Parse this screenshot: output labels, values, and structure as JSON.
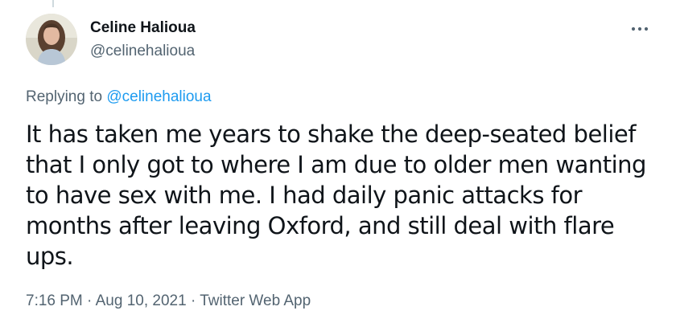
{
  "tweet": {
    "author": {
      "display_name": "Celine Halioua",
      "handle": "@celinehalioua",
      "avatar_icon": "avatar-photo"
    },
    "more_icon": "more-horizontal-icon",
    "reply_context": {
      "prefix": "Replying to ",
      "mention": "@celinehalioua"
    },
    "text_lines": [
      "It has taken me years to shake the deep-seated belief",
      "that I only got to where I am due to older men wanting",
      "to have sex with me. I had daily panic attacks for",
      "months after leaving Oxford, and still deal with flare",
      "ups."
    ],
    "meta": {
      "time": "7:16 PM",
      "separator": "·",
      "date": "Aug 10, 2021",
      "source": "Twitter Web App"
    }
  },
  "colors": {
    "text_primary": "#0f1419",
    "text_secondary": "#536471",
    "link": "#1d9bf0",
    "thread_line": "#cfd9de"
  }
}
